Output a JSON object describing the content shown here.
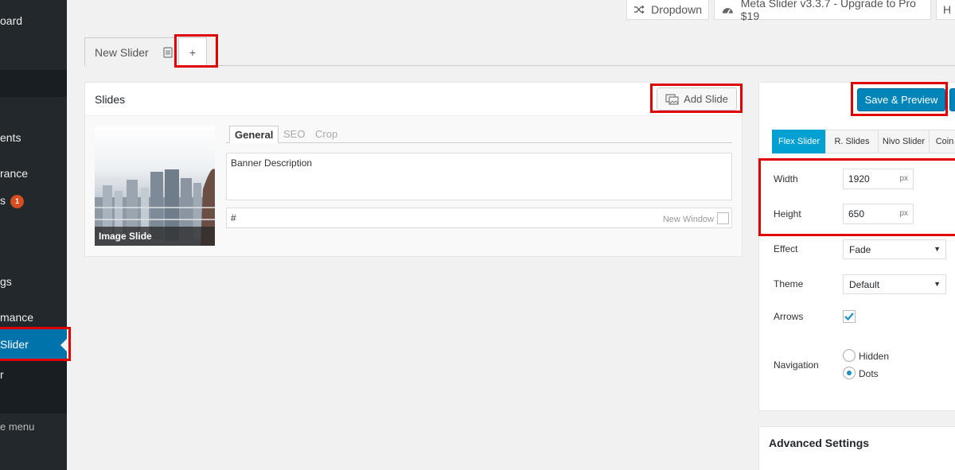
{
  "sidebar": {
    "items": [
      {
        "label": "oard"
      },
      {
        "label": "ents"
      },
      {
        "label": "rance"
      },
      {
        "label": "s",
        "badge": "1"
      },
      {
        "label": "gs"
      },
      {
        "label": "mance"
      },
      {
        "label": "Slider"
      },
      {
        "label": "r"
      },
      {
        "label": "e menu"
      }
    ]
  },
  "topbar": {
    "dropdown_label": "Dropdown",
    "upgrade_label": "Meta Slider v3.3.7 - Upgrade to Pro $19",
    "help_label": "H"
  },
  "tabs": {
    "slider_name": "New Slider",
    "add_tab_label": "+"
  },
  "slides_panel": {
    "title": "Slides",
    "add_slide_label": "Add Slide",
    "slide": {
      "thumbnail_caption": "Image Slide",
      "subtabs": [
        "General",
        "SEO",
        "Crop"
      ],
      "caption_text": "Banner Description",
      "url_value": "#",
      "new_window_label": "New Window"
    }
  },
  "settings": {
    "save_preview_label": "Save & Preview",
    "slider_types": [
      "Flex Slider",
      "R. Slides",
      "Nivo Slider",
      "Coin"
    ],
    "active_type": "Flex Slider",
    "width_label": "Width",
    "width_value": "1920",
    "height_label": "Height",
    "height_value": "650",
    "unit": "px",
    "effect_label": "Effect",
    "effect_value": "Fade",
    "theme_label": "Theme",
    "theme_value": "Default",
    "arrows_label": "Arrows",
    "arrows_checked": true,
    "navigation_label": "Navigation",
    "navigation_options": [
      "Hidden",
      "Dots"
    ],
    "navigation_selected": "Dots",
    "advanced_title": "Advanced Settings"
  },
  "colors": {
    "sidebar_bg": "#23282d",
    "sidebar_active": "#0073aa",
    "primary_button": "#0085ba",
    "tab_active": "#00a0d2",
    "highlight_red": "#e00000",
    "badge": "#d54e21"
  }
}
